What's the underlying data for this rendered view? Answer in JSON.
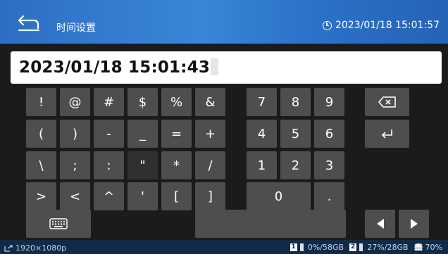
{
  "header": {
    "title": "时间设置",
    "clock": "2023/01/18 15:01:57"
  },
  "display": {
    "value": "2023/01/18  15:01:43"
  },
  "keys": {
    "symbols": [
      [
        "!",
        "@",
        "#",
        "$",
        "%",
        "&"
      ],
      [
        "(",
        ")",
        "-",
        "_",
        "=",
        "+"
      ],
      [
        "\\",
        ";",
        ":",
        "\"",
        "*",
        "/"
      ],
      [
        ">",
        "<",
        "^",
        "'",
        "[",
        "]"
      ]
    ],
    "digits": [
      [
        "7",
        "8",
        "9"
      ],
      [
        "4",
        "5",
        "6"
      ],
      [
        "1",
        "2",
        "3"
      ]
    ],
    "zero": "0",
    "dot": "."
  },
  "statusbar": {
    "resolution": "1920×1080p",
    "disk1_label": "1",
    "disk1": "0%/58GB",
    "disk2_label": "2",
    "disk2": "27%/28GB",
    "memory": "70%"
  },
  "colors": {
    "header": "#3a86d8",
    "key": "#4e4e4e",
    "key_dark": "#303030",
    "statusbar": "#102a4a"
  },
  "icons": {
    "back": "back-arrow-icon",
    "clock": "clock-icon",
    "backspace": "backspace-icon",
    "enter": "enter-icon",
    "keyboard": "keyboard-icon",
    "left": "arrow-left-icon",
    "right": "arrow-right-icon",
    "resolution": "display-output-icon",
    "disk": "disk-icon",
    "memory": "database-icon"
  }
}
